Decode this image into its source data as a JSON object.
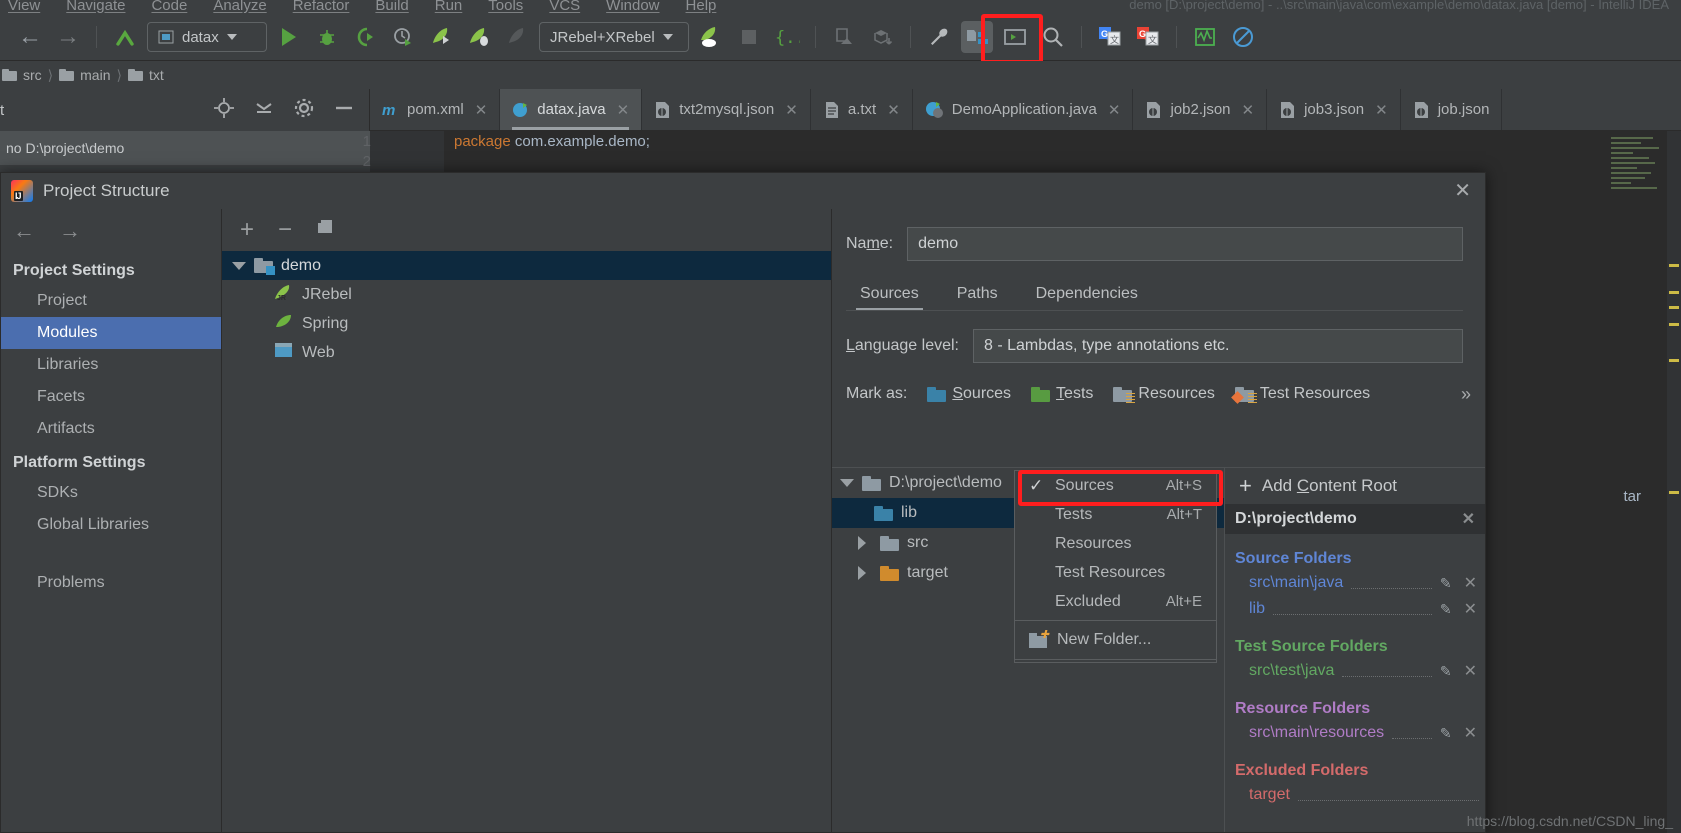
{
  "menubar": {
    "items": [
      "View",
      "Navigate",
      "Code",
      "Analyze",
      "Refactor",
      "Build",
      "Run",
      "Tools",
      "VCS",
      "Window",
      "Help"
    ],
    "window_caption": "demo [D:\\project\\demo] - ..\\src\\main\\java\\com\\example\\demo\\datax.java [demo] - IntelliJ IDEA"
  },
  "toolbar": {
    "back_icon": "back-arrow-icon",
    "forward_icon": "forward-arrow-icon",
    "update_icon": "update-project-icon",
    "run_config": "datax",
    "run_config2": "JRebel+XRebel",
    "icons": [
      "run-icon",
      "debug-icon",
      "run-with-coverage-icon",
      "profile-icon",
      "jrebel-run-icon",
      "jrebel-debug-icon",
      "jrebel-stop-icon"
    ],
    "icons2": [
      "jrebel-cloud-icon",
      "stop-icon",
      "braces-icon",
      "upload-icon",
      "download-icon",
      "settings-wrench-icon",
      "project-structure-icon",
      "terminal-icon",
      "search-icon",
      "google-translate-blue-icon",
      "google-translate-red-icon",
      "monitor-icon",
      "no-entry-icon"
    ]
  },
  "breadcrumb": {
    "items": [
      "src",
      "main",
      "txt"
    ]
  },
  "project_tool": {
    "title_fragment": "t",
    "path_label": "no D:\\project\\demo",
    "icons": [
      "locate-icon",
      "collapse-all-icon",
      "settings-gear-icon",
      "hide-icon"
    ]
  },
  "editor_tabs": [
    {
      "label": "pom.xml",
      "icon": "maven-icon",
      "active": false
    },
    {
      "label": "datax.java",
      "icon": "java-class-icon",
      "active": true
    },
    {
      "label": "txt2mysql.json",
      "icon": "json-icon",
      "active": false
    },
    {
      "label": "a.txt",
      "icon": "text-file-icon",
      "active": false
    },
    {
      "label": "DemoApplication.java",
      "icon": "spring-class-icon",
      "active": false
    },
    {
      "label": "job2.json",
      "icon": "json-icon",
      "active": false
    },
    {
      "label": "job3.json",
      "icon": "json-icon",
      "active": false
    },
    {
      "label": "job.json",
      "icon": "json-icon",
      "active": false
    }
  ],
  "editor": {
    "line_numbers": [
      "1",
      "2"
    ],
    "code_keyword": "package",
    "code_text": " com.example.demo;"
  },
  "dialog": {
    "title": "Project Structure",
    "close_icon": "close-icon",
    "nav_back_icon": "nav-back-icon",
    "nav_forward_icon": "nav-forward-icon",
    "groups": [
      {
        "label": "Project Settings",
        "items": [
          {
            "label": "Project",
            "selected": false
          },
          {
            "label": "Modules",
            "selected": true
          },
          {
            "label": "Libraries",
            "selected": false
          },
          {
            "label": "Facets",
            "selected": false
          },
          {
            "label": "Artifacts",
            "selected": false
          }
        ]
      },
      {
        "label": "Platform Settings",
        "items": [
          {
            "label": "SDKs",
            "selected": false
          },
          {
            "label": "Global Libraries",
            "selected": false
          }
        ]
      }
    ],
    "problems_label": "Problems",
    "module_pane": {
      "toolbar_icons": [
        "add-icon",
        "remove-icon",
        "copy-icon"
      ],
      "tree": [
        {
          "label": "demo",
          "icon": "module-folder-icon",
          "selected": true,
          "depth": 0,
          "expanded": true
        },
        {
          "label": "JRebel",
          "icon": "jrebel-facet-icon",
          "selected": false,
          "depth": 1
        },
        {
          "label": "Spring",
          "icon": "spring-facet-icon",
          "selected": false,
          "depth": 1
        },
        {
          "label": "Web",
          "icon": "web-facet-icon",
          "selected": false,
          "depth": 1
        }
      ]
    },
    "detail": {
      "name_label": "Name:",
      "name_label_mnemonic": "m",
      "name_value": "demo",
      "tabs": [
        {
          "label": "Sources",
          "active": true
        },
        {
          "label": "Paths",
          "active": false
        },
        {
          "label": "Dependencies",
          "active": false
        }
      ],
      "language_level_label": "Language level:",
      "language_level_value": "8 - Lambdas, type annotations etc.",
      "mark_as_label": "Mark as:",
      "mark_as_options": [
        {
          "label": "Sources",
          "mnemonic": "S",
          "color": "blue"
        },
        {
          "label": "Tests",
          "mnemonic": "T",
          "color": "green"
        },
        {
          "label": "Resources",
          "mnemonic": "",
          "color": "gray"
        },
        {
          "label": "Test Resources",
          "mnemonic": "",
          "color": "tres"
        }
      ],
      "mark_as_overflow": "»",
      "folder_tree": [
        {
          "label": "D:\\project\\demo",
          "depth": 0,
          "expanded": true,
          "selected": false,
          "folder": "gray"
        },
        {
          "label": "lib",
          "depth": 1,
          "expanded": null,
          "selected": true,
          "folder": "blue"
        },
        {
          "label": "src",
          "depth": 1,
          "expanded": false,
          "selected": false,
          "folder": "gray"
        },
        {
          "label": "target",
          "depth": 1,
          "expanded": false,
          "selected": false,
          "folder": "orange"
        }
      ],
      "add_content_root": "Add Content Root",
      "add_content_root_mnemonic": "C",
      "content_root_path": "D:\\project\\demo",
      "content_root_remove_icon": "close-icon",
      "sections": [
        {
          "title": "Source Folders",
          "kind": "src",
          "paths": [
            {
              "path": "src\\main\\java"
            },
            {
              "path": "lib"
            }
          ]
        },
        {
          "title": "Test Source Folders",
          "kind": "test",
          "paths": [
            {
              "path": "src\\test\\java"
            }
          ]
        },
        {
          "title": "Resource Folders",
          "kind": "res",
          "paths": [
            {
              "path": "src\\main\\resources"
            }
          ]
        },
        {
          "title": "Excluded Folders",
          "kind": "exc",
          "paths": [
            {
              "path": "target"
            }
          ]
        }
      ]
    }
  },
  "context_menu": {
    "items": [
      {
        "label": "Sources",
        "shortcut": "Alt+S",
        "checked": true
      },
      {
        "label": "Tests",
        "shortcut": "Alt+T",
        "checked": false
      },
      {
        "label": "Resources",
        "shortcut": "",
        "checked": false
      },
      {
        "label": "Test Resources",
        "shortcut": "",
        "checked": false
      },
      {
        "label": "Excluded",
        "shortcut": "Alt+E",
        "checked": false
      }
    ],
    "new_folder_label": "New Folder...",
    "new_folder_icon": "new-folder-icon"
  },
  "highlight": {
    "color": "#ff1e1e",
    "toolbar_target": "project-structure-icon",
    "menu_target": "Sources"
  },
  "watermark": "https://blog.csdn.net/CSDN_ling_",
  "editor_right": {
    "tar_label": "tar"
  }
}
